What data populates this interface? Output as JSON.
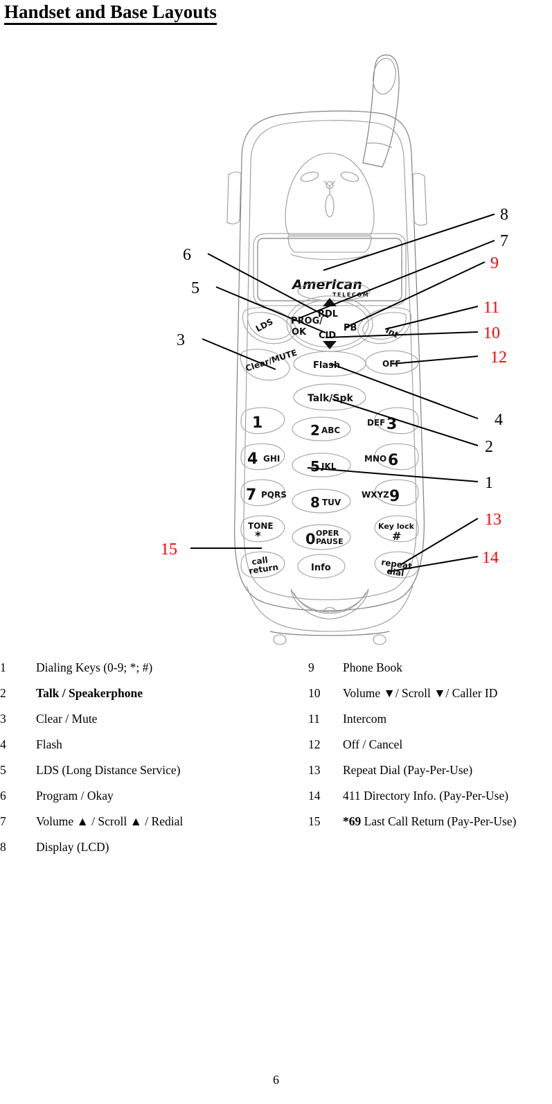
{
  "document": {
    "title": "Handset and Base Layouts",
    "page_number": "6"
  },
  "figure": {
    "brand": {
      "name": "American",
      "sub": "TELECOM"
    },
    "buttons": {
      "lds": "LDS",
      "prog_ok_line1": "PROG/",
      "prog_ok_line2": "OK",
      "rdl": "RDL",
      "pb": "PB",
      "cid": "CID",
      "int": "Int",
      "clear_mute": "Clear/MUTE",
      "flash": "Flash",
      "off": "OFF",
      "talk_spk": "Talk/Spk",
      "key_1": "1",
      "key_2_digit": "2",
      "key_2_letters": "ABC",
      "key_3_digit": "3",
      "key_3_letters": "DEF",
      "key_4_digit": "4",
      "key_4_letters": "GHI",
      "key_5_digit": "5",
      "key_5_letters": "JKL",
      "key_6_digit": "6",
      "key_6_letters": "MNO",
      "key_7_digit": "7",
      "key_7_letters": "PQRS",
      "key_8_digit": "8",
      "key_8_letters": "TUV",
      "key_9_digit": "9",
      "key_9_letters": "WXYZ",
      "key_star_top": "TONE",
      "key_star_sym": "*",
      "key_0_digit": "0",
      "key_0_line1": "OPER",
      "key_0_line2": "PAUSE",
      "key_hash_top": "Key lock",
      "key_hash_sym": "#",
      "call_return_line1": "call",
      "call_return_line2": "return",
      "info": "Info",
      "repeat_dial_line1": "repeat",
      "repeat_dial_line2": "dial"
    },
    "callouts": [
      {
        "label": "8",
        "color": "#000000"
      },
      {
        "label": "7",
        "color": "#000000"
      },
      {
        "label": "9",
        "color": "#ff0000"
      },
      {
        "label": "11",
        "color": "#ff0000"
      },
      {
        "label": "10",
        "color": "#ff0000"
      },
      {
        "label": "12",
        "color": "#ff0000"
      },
      {
        "label": "4",
        "color": "#000000"
      },
      {
        "label": "2",
        "color": "#000000"
      },
      {
        "label": "1",
        "color": "#000000"
      },
      {
        "label": "13",
        "color": "#ff0000"
      },
      {
        "label": "14",
        "color": "#ff0000"
      },
      {
        "label": "6",
        "color": "#000000"
      },
      {
        "label": "5",
        "color": "#000000"
      },
      {
        "label": "3",
        "color": "#000000"
      },
      {
        "label": "15",
        "color": "#ff0000"
      }
    ]
  },
  "legend": {
    "left": [
      {
        "num": "1",
        "text": "Dialing Keys (0-9; *; #)",
        "bold": false
      },
      {
        "num": "2",
        "text": "Talk / Speakerphone",
        "bold": true
      },
      {
        "num": "3",
        "text": "Clear / Mute",
        "bold": false
      },
      {
        "num": "4",
        "text": "Flash",
        "bold": false
      },
      {
        "num": "5",
        "text": "LDS (Long Distance Service)",
        "bold": false
      },
      {
        "num": "6",
        "text": "Program / Okay",
        "bold": false
      },
      {
        "num": "7",
        "text": "Volume ▲ / Scroll ▲ / Redial",
        "bold": false
      },
      {
        "num": "8",
        "text": "Display (LCD)",
        "bold": false
      }
    ],
    "right": [
      {
        "num": "9",
        "text": "Phone Book",
        "bold": false
      },
      {
        "num": "10",
        "text": "Volume ▼/ Scroll ▼/ Caller ID",
        "bold": false
      },
      {
        "num": "11",
        "text": "Intercom",
        "bold": false
      },
      {
        "num": "12",
        "text": "Off / Cancel",
        "bold": false
      },
      {
        "num": "13",
        "text": "Repeat Dial (Pay-Per-Use)",
        "bold": false
      },
      {
        "num": "14",
        "text": "411 Directory Info. (Pay-Per-Use)",
        "bold": false
      },
      {
        "num": "15",
        "text_html": "<b>*69</b> Last Call Return (Pay-Per-Use)",
        "bold": false
      }
    ]
  }
}
